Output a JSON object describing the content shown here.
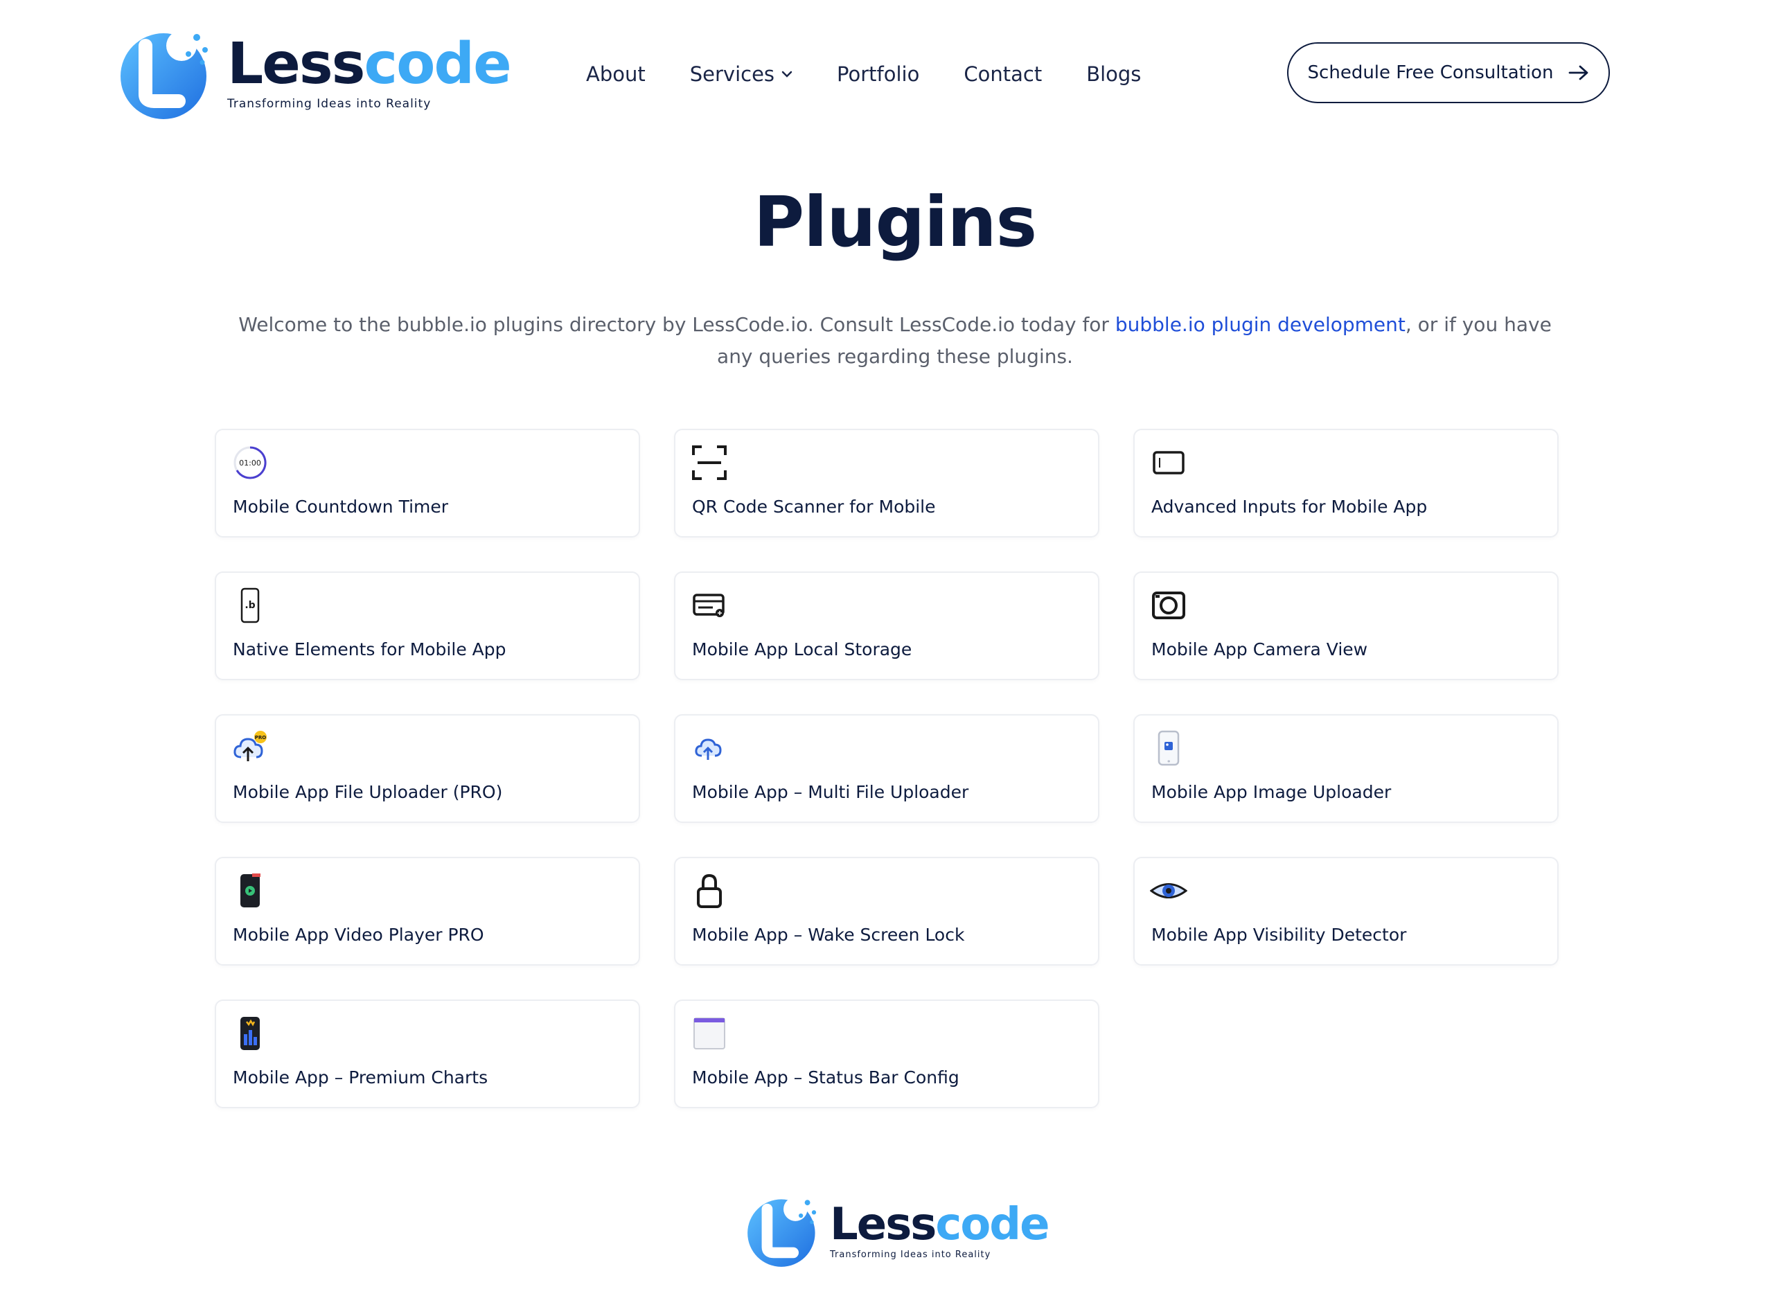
{
  "brand": {
    "name_part1": "Less",
    "name_part2": "code",
    "tagline": "Transforming Ideas into Reality"
  },
  "nav": {
    "items": [
      {
        "label": "About"
      },
      {
        "label": "Services",
        "has_dropdown": true
      },
      {
        "label": "Portfolio"
      },
      {
        "label": "Contact"
      },
      {
        "label": "Blogs"
      }
    ]
  },
  "cta": {
    "label": "Schedule Free Consultation"
  },
  "page": {
    "title": "Plugins",
    "intro_before": "Welcome to the bubble.io plugins directory by LessCode.io. Consult LessCode.io today for ",
    "intro_link": "bubble.io plugin development",
    "intro_after": ", or if you have any queries regarding these plugins."
  },
  "plugins": [
    {
      "name": "Mobile Countdown Timer",
      "icon": "countdown-timer-icon",
      "timer_text": "01:00"
    },
    {
      "name": "QR Code Scanner for Mobile",
      "icon": "qr-scan-icon"
    },
    {
      "name": "Advanced Inputs for Mobile App",
      "icon": "input-box-icon"
    },
    {
      "name": "Native Elements for Mobile App",
      "icon": "phone-bubble-icon",
      "glyph": ".b"
    },
    {
      "name": "Mobile App Local Storage",
      "icon": "local-storage-icon"
    },
    {
      "name": "Mobile App Camera View",
      "icon": "camera-icon"
    },
    {
      "name": "Mobile App File Uploader (PRO)",
      "icon": "cloud-upload-pro-icon",
      "badge": "PRO"
    },
    {
      "name": "Mobile App – Multi File Uploader",
      "icon": "cloud-upload-icon"
    },
    {
      "name": "Mobile App Image Uploader",
      "icon": "phone-image-icon"
    },
    {
      "name": "Mobile App Video Player PRO",
      "icon": "phone-video-icon"
    },
    {
      "name": "Mobile App – Wake Screen Lock",
      "icon": "padlock-icon"
    },
    {
      "name": "Mobile App Visibility Detector",
      "icon": "eye-icon"
    },
    {
      "name": "Mobile App – Premium Charts",
      "icon": "phone-chart-icon"
    },
    {
      "name": "Mobile App – Status Bar Config",
      "icon": "status-bar-window-icon"
    }
  ],
  "colors": {
    "navy": "#0d1b3e",
    "brand_blue": "#3da9f5",
    "link_blue": "#1f4ed8",
    "body_text": "#5a5f6b",
    "card_border": "#eceef2"
  }
}
